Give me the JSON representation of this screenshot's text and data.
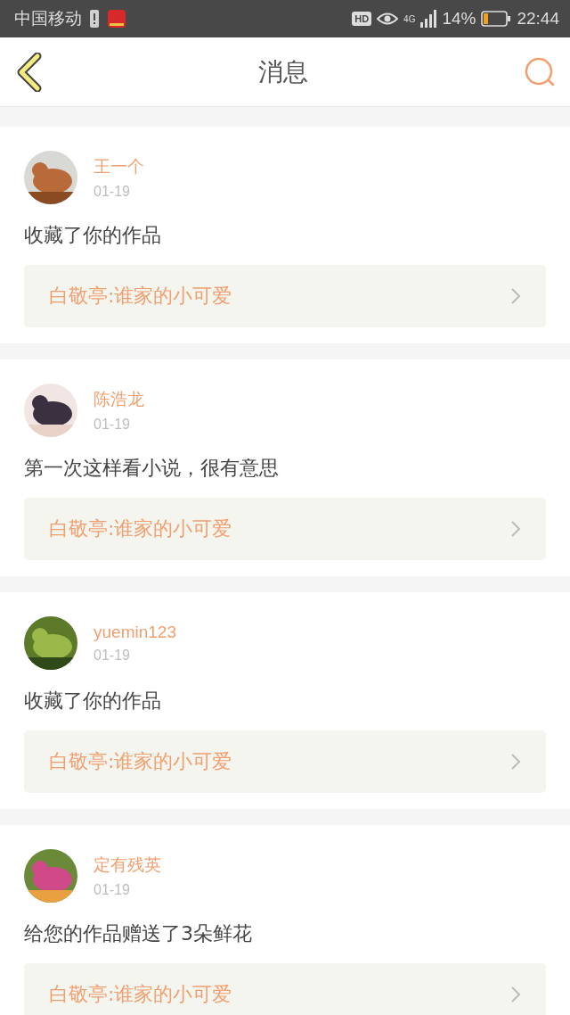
{
  "status_bar": {
    "carrier": "中国移动",
    "hd_label": "HD",
    "network": "4G",
    "battery_percent": "14%",
    "time": "22:44"
  },
  "header": {
    "title": "消息"
  },
  "messages": [
    {
      "user": "王一个",
      "date": "01-19",
      "text": "收藏了你的作品",
      "work": "白敬亭:谁家的小可爱"
    },
    {
      "user": "陈浩龙",
      "date": "01-19",
      "text": "第一次这样看小说，很有意思",
      "work": "白敬亭:谁家的小可爱"
    },
    {
      "user": "yuemin123",
      "date": "01-19",
      "text": "收藏了你的作品",
      "work": "白敬亭:谁家的小可爱"
    },
    {
      "user": "定有残英",
      "date": "01-19",
      "text": "给您的作品赠送了3朵鲜花",
      "work": "白敬亭:谁家的小可爱"
    }
  ]
}
